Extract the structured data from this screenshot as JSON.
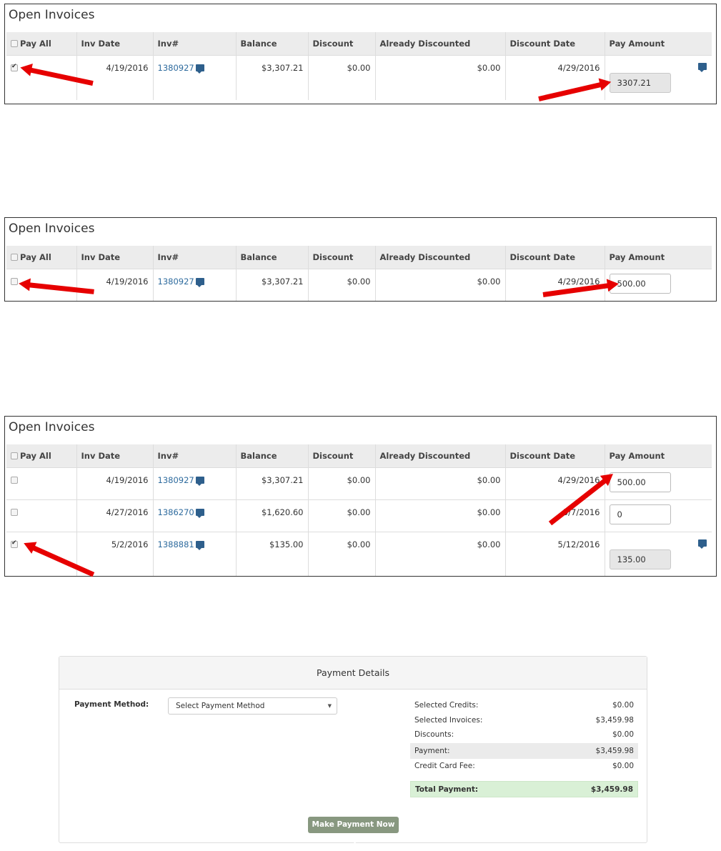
{
  "headers": {
    "pay_all": "Pay All",
    "inv_date": "Inv Date",
    "inv_num": "Inv#",
    "balance": "Balance",
    "discount": "Discount",
    "already_discounted": "Already Discounted",
    "discount_date": "Discount Date",
    "pay_amount": "Pay Amount"
  },
  "panel1": {
    "title": "Open Invoices",
    "rows": [
      {
        "checked": true,
        "inv_date": "4/19/2016",
        "inv_num": "1380927",
        "balance": "$3,307.21",
        "discount": "$0.00",
        "already_discounted": "$0.00",
        "discount_date": "4/29/2016",
        "pay_amount": "3307.21"
      }
    ]
  },
  "panel2": {
    "title": "Open Invoices",
    "rows": [
      {
        "checked": false,
        "inv_date": "4/19/2016",
        "inv_num": "1380927",
        "balance": "$3,307.21",
        "discount": "$0.00",
        "already_discounted": "$0.00",
        "discount_date": "4/29/2016",
        "pay_amount": "500.00"
      }
    ]
  },
  "panel3": {
    "title": "Open Invoices",
    "rows": [
      {
        "checked": false,
        "inv_date": "4/19/2016",
        "inv_num": "1380927",
        "balance": "$3,307.21",
        "discount": "$0.00",
        "already_discounted": "$0.00",
        "discount_date": "4/29/2016",
        "pay_amount": "500.00"
      },
      {
        "checked": false,
        "inv_date": "4/27/2016",
        "inv_num": "1386270",
        "balance": "$1,620.60",
        "discount": "$0.00",
        "already_discounted": "$0.00",
        "discount_date": "5/7/2016",
        "pay_amount": "0"
      },
      {
        "checked": true,
        "inv_date": "5/2/2016",
        "inv_num": "1388881",
        "balance": "$135.00",
        "discount": "$0.00",
        "already_discounted": "$0.00",
        "discount_date": "5/12/2016",
        "pay_amount": "135.00"
      }
    ]
  },
  "payment": {
    "title": "Payment Details",
    "method_label": "Payment Method:",
    "method_placeholder": "Select Payment Method",
    "selected_credits_label": "Selected Credits:",
    "selected_credits": "$0.00",
    "selected_invoices_label": "Selected Invoices:",
    "selected_invoices": "$3,459.98",
    "discounts_label": "Discounts:",
    "discounts": "$0.00",
    "payment_label": "Payment:",
    "payment": "$3,459.98",
    "cc_fee_label": "Credit Card Fee:",
    "cc_fee": "$0.00",
    "total_label": "Total Payment:",
    "total": "$3,459.98",
    "button": "Make Payment Now"
  },
  "colors": {
    "accent_link": "#2e6b9e",
    "annotation_arrow": "#e60000",
    "button_bg": "#889880",
    "total_bg": "#d9f0d6"
  }
}
